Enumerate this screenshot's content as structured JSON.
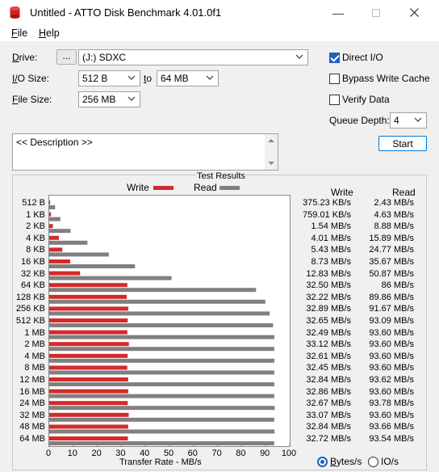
{
  "window": {
    "title": "Untitled - ATTO Disk Benchmark 4.01.0f1",
    "icon": "atto-app-icon"
  },
  "menu": {
    "file": "File",
    "help": "Help"
  },
  "settings": {
    "drive_label": "Drive:",
    "drive_browse": "...",
    "drive_value": "(J:) SDXC",
    "io_size_label": "I/O Size:",
    "io_from": "512 B",
    "io_to_word": "to",
    "io_to": "64 MB",
    "file_size_label": "File Size:",
    "file_size": "256 MB",
    "direct_io": {
      "label": "Direct I/O",
      "checked": true
    },
    "bypass_cache": {
      "label": "Bypass Write Cache",
      "checked": false
    },
    "verify_data": {
      "label": "Verify Data",
      "checked": false
    },
    "queue_depth_label": "Queue Depth:",
    "queue_depth": "4",
    "description": "<< Description >>",
    "start_button": "Start"
  },
  "results": {
    "title": "Test Results",
    "legend_write": "Write",
    "legend_read": "Read",
    "col_write": "Write",
    "col_read": "Read",
    "xlabel": "Transfer Rate - MB/s",
    "units_bytes": "Bytes/s",
    "units_io": "IO/s",
    "units_selected": "Bytes/s",
    "colors": {
      "write": "#d42a2a",
      "read": "#808080"
    }
  },
  "chart_data": {
    "type": "bar",
    "orientation": "horizontal",
    "xlabel": "Transfer Rate - MB/s",
    "xlim": [
      0,
      100
    ],
    "xticks": [
      "0",
      "10",
      "20",
      "30",
      "40",
      "50",
      "60",
      "70",
      "80",
      "90",
      "100"
    ],
    "categories": [
      "512 B",
      "1 KB",
      "2 KB",
      "4 KB",
      "8 KB",
      "16 KB",
      "32 KB",
      "64 KB",
      "128 KB",
      "256 KB",
      "512 KB",
      "1 MB",
      "2 MB",
      "4 MB",
      "8 MB",
      "12 MB",
      "16 MB",
      "24 MB",
      "32 MB",
      "48 MB",
      "64 MB"
    ],
    "series": [
      {
        "name": "Write",
        "values": [
          0.37523,
          0.75901,
          1.54,
          4.01,
          5.43,
          8.73,
          12.83,
          32.5,
          32.22,
          32.89,
          32.65,
          32.49,
          33.12,
          32.61,
          32.45,
          32.84,
          32.86,
          32.67,
          33.07,
          32.84,
          32.72
        ]
      },
      {
        "name": "Read",
        "values": [
          2.43,
          4.63,
          8.88,
          15.89,
          24.77,
          35.67,
          50.87,
          86,
          89.86,
          91.67,
          93.09,
          93.6,
          93.6,
          93.6,
          93.6,
          93.62,
          93.6,
          93.78,
          93.6,
          93.66,
          93.54
        ]
      }
    ],
    "write_text": [
      "375.23 KB/s",
      "759.01 KB/s",
      "1.54 MB/s",
      "4.01 MB/s",
      "5.43 MB/s",
      "8.73 MB/s",
      "12.83 MB/s",
      "32.50 MB/s",
      "32.22 MB/s",
      "32.89 MB/s",
      "32.65 MB/s",
      "32.49 MB/s",
      "33.12 MB/s",
      "32.61 MB/s",
      "32.45 MB/s",
      "32.84 MB/s",
      "32.86 MB/s",
      "32.67 MB/s",
      "33.07 MB/s",
      "32.84 MB/s",
      "32.72 MB/s"
    ],
    "read_text": [
      "2.43 MB/s",
      "4.63 MB/s",
      "8.88 MB/s",
      "15.89 MB/s",
      "24.77 MB/s",
      "35.67 MB/s",
      "50.87 MB/s",
      "86 MB/s",
      "89.86 MB/s",
      "91.67 MB/s",
      "93.09 MB/s",
      "93.60 MB/s",
      "93.60 MB/s",
      "93.60 MB/s",
      "93.60 MB/s",
      "93.62 MB/s",
      "93.60 MB/s",
      "93.78 MB/s",
      "93.60 MB/s",
      "93.66 MB/s",
      "93.54 MB/s"
    ]
  }
}
